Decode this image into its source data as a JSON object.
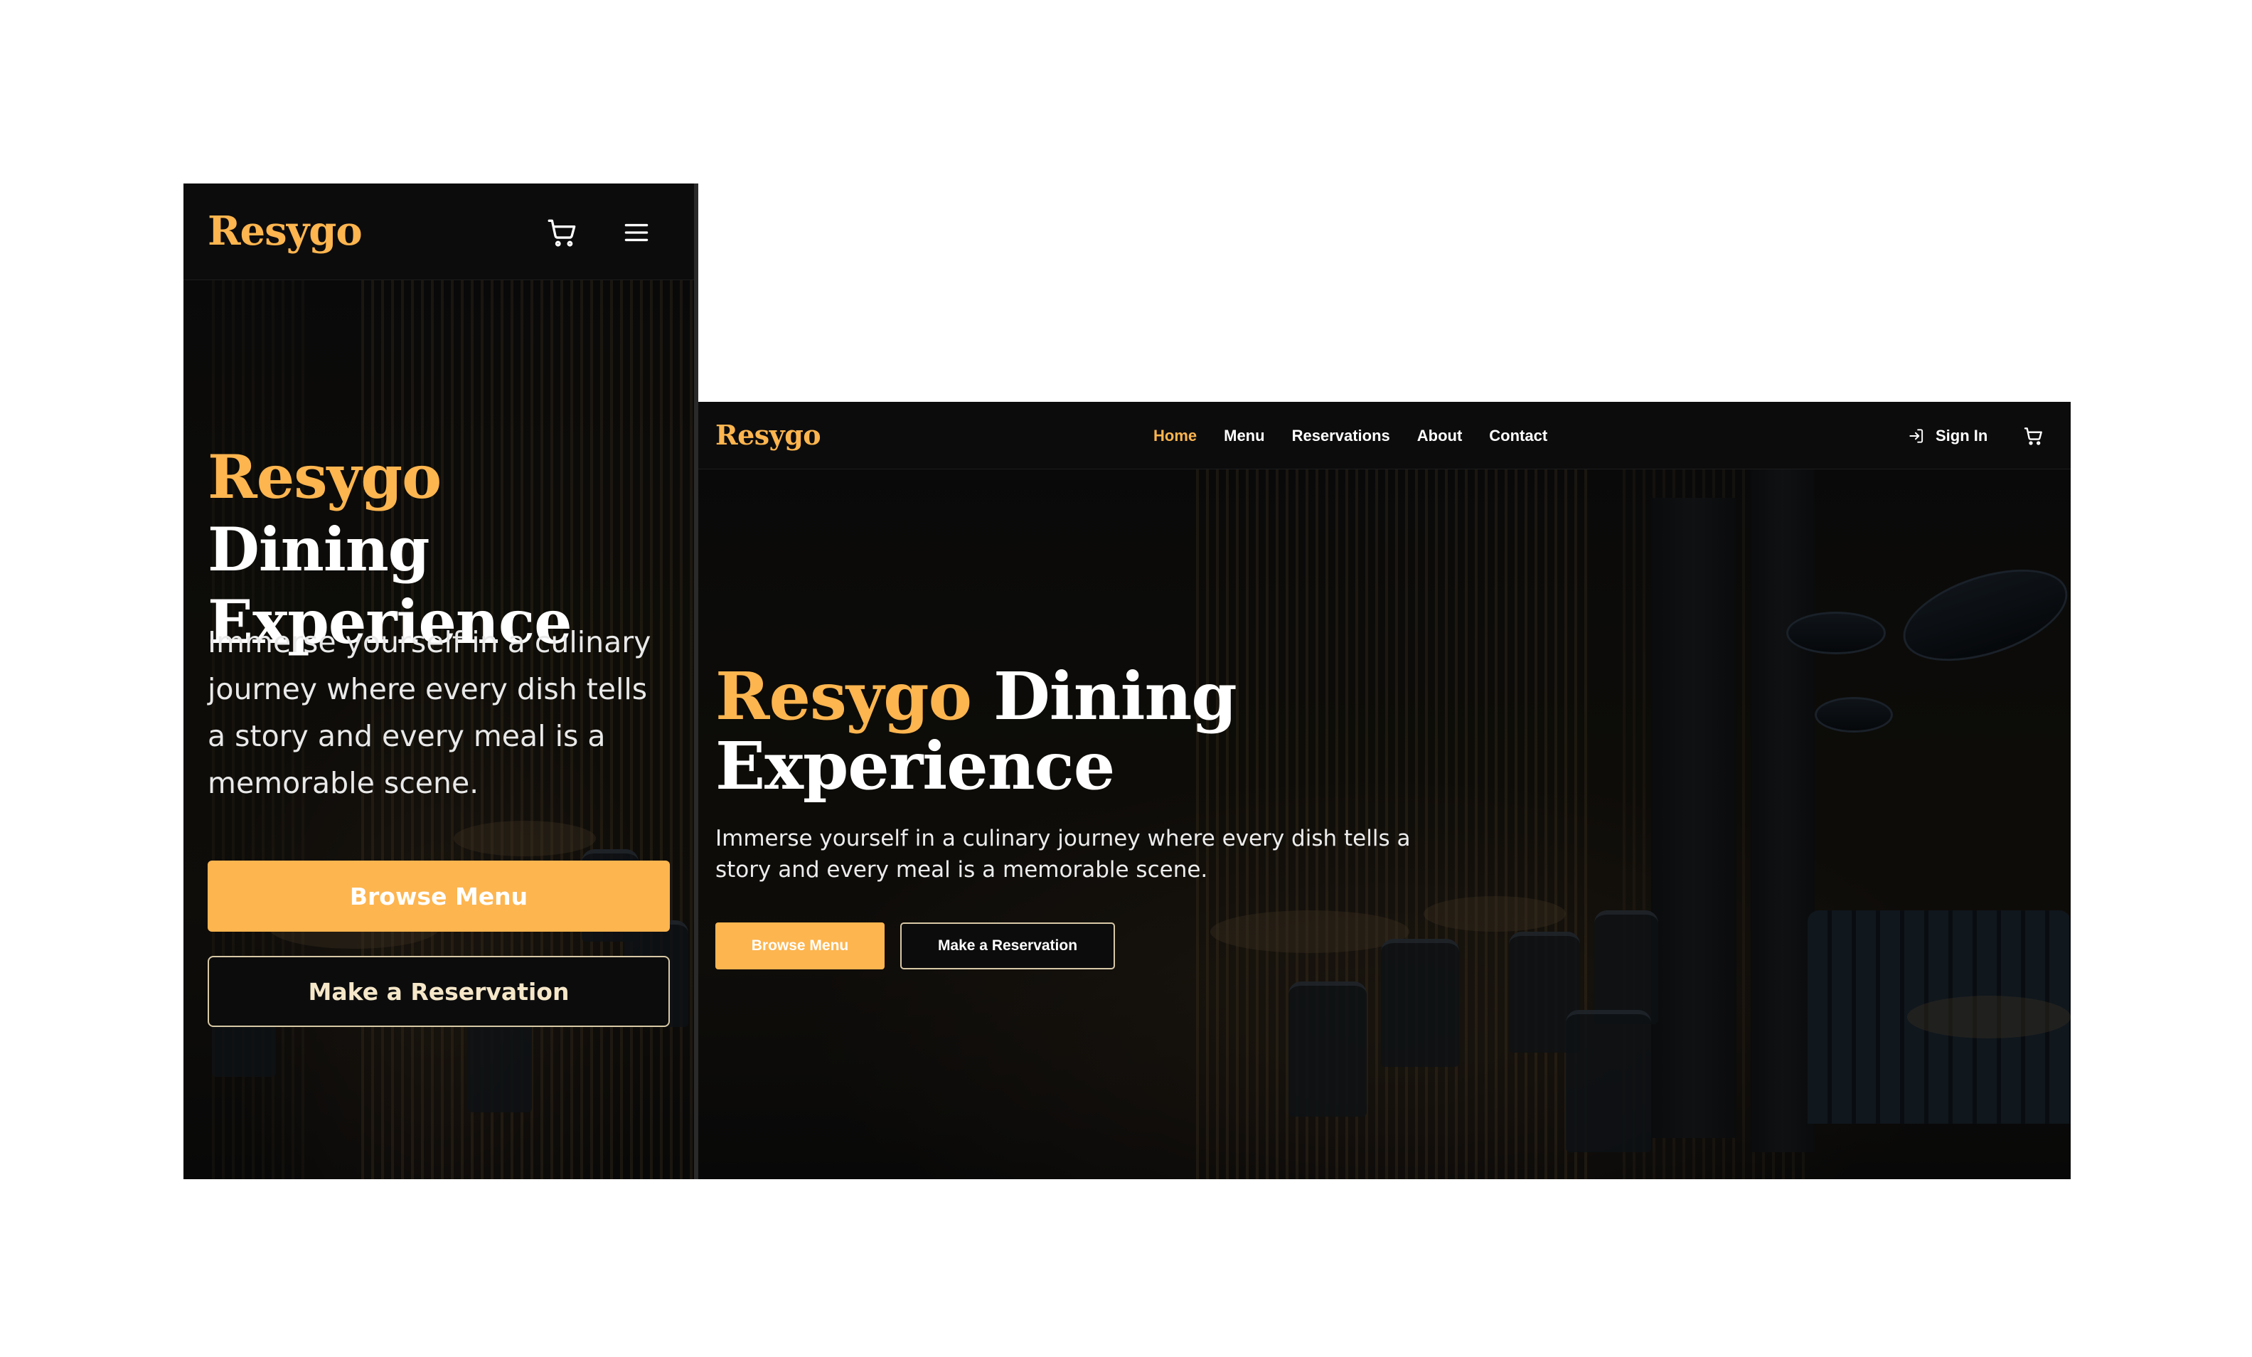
{
  "brand": {
    "name": "Resygo",
    "accent_color": "#FDB54F",
    "background": "#0d0d0e"
  },
  "mobile": {
    "header": {
      "logo": "Resygo",
      "cart_icon": "cart-icon",
      "menu_icon": "hamburger-menu-icon"
    },
    "hero": {
      "title_accent": "Resygo",
      "title_rest": " Dining Experience",
      "subtitle": "Immerse yourself in a culinary journey where every dish tells a story and every meal is a memorable scene.",
      "primary_button": "Browse Menu",
      "secondary_button": "Make a Reservation"
    }
  },
  "desktop": {
    "header": {
      "logo": "Resygo",
      "nav": [
        {
          "label": "Home",
          "active": true
        },
        {
          "label": "Menu",
          "active": false
        },
        {
          "label": "Reservations",
          "active": false
        },
        {
          "label": "About",
          "active": false
        },
        {
          "label": "Contact",
          "active": false
        }
      ],
      "sign_in": "Sign In",
      "sign_in_icon": "sign-in-icon",
      "cart_icon": "cart-icon"
    },
    "hero": {
      "title_accent": "Resygo",
      "title_rest": " Dining Experience",
      "subtitle": "Immerse yourself in a culinary journey where every dish tells a story and every meal is a memorable scene.",
      "primary_button": "Browse Menu",
      "secondary_button": "Make a Reservation"
    }
  }
}
